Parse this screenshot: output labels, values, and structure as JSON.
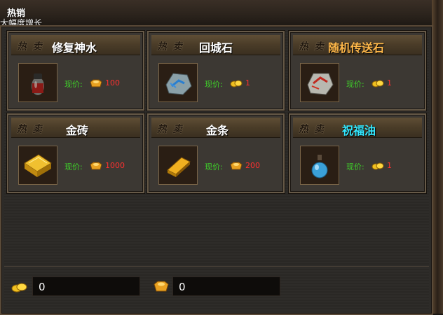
{
  "header": {
    "tab_title": "热销",
    "subtitle": "大幅度增长"
  },
  "hot_label": "热卖",
  "price_label": "现价:",
  "items": [
    {
      "name": "修复神水",
      "price": "100",
      "currency": "ingot",
      "name_color": "#ffffff",
      "icon": "potion-jar-icon"
    },
    {
      "name": "回城石",
      "price": "1",
      "currency": "gold",
      "name_color": "#ffffff",
      "icon": "town-stone-icon"
    },
    {
      "name": "随机传送石",
      "price": "1",
      "currency": "gold",
      "name_color": "#ffb84a",
      "icon": "teleport-stone-icon"
    },
    {
      "name": "金砖",
      "price": "1000",
      "currency": "ingot",
      "name_color": "#ffffff",
      "icon": "gold-brick-icon"
    },
    {
      "name": "金条",
      "price": "200",
      "currency": "ingot",
      "name_color": "#ffffff",
      "icon": "gold-bar-icon"
    },
    {
      "name": "祝福油",
      "price": "1",
      "currency": "gold",
      "name_color": "#33e8ff",
      "icon": "blessing-oil-icon"
    }
  ],
  "balances": {
    "gold": "0",
    "ingot": "0"
  }
}
